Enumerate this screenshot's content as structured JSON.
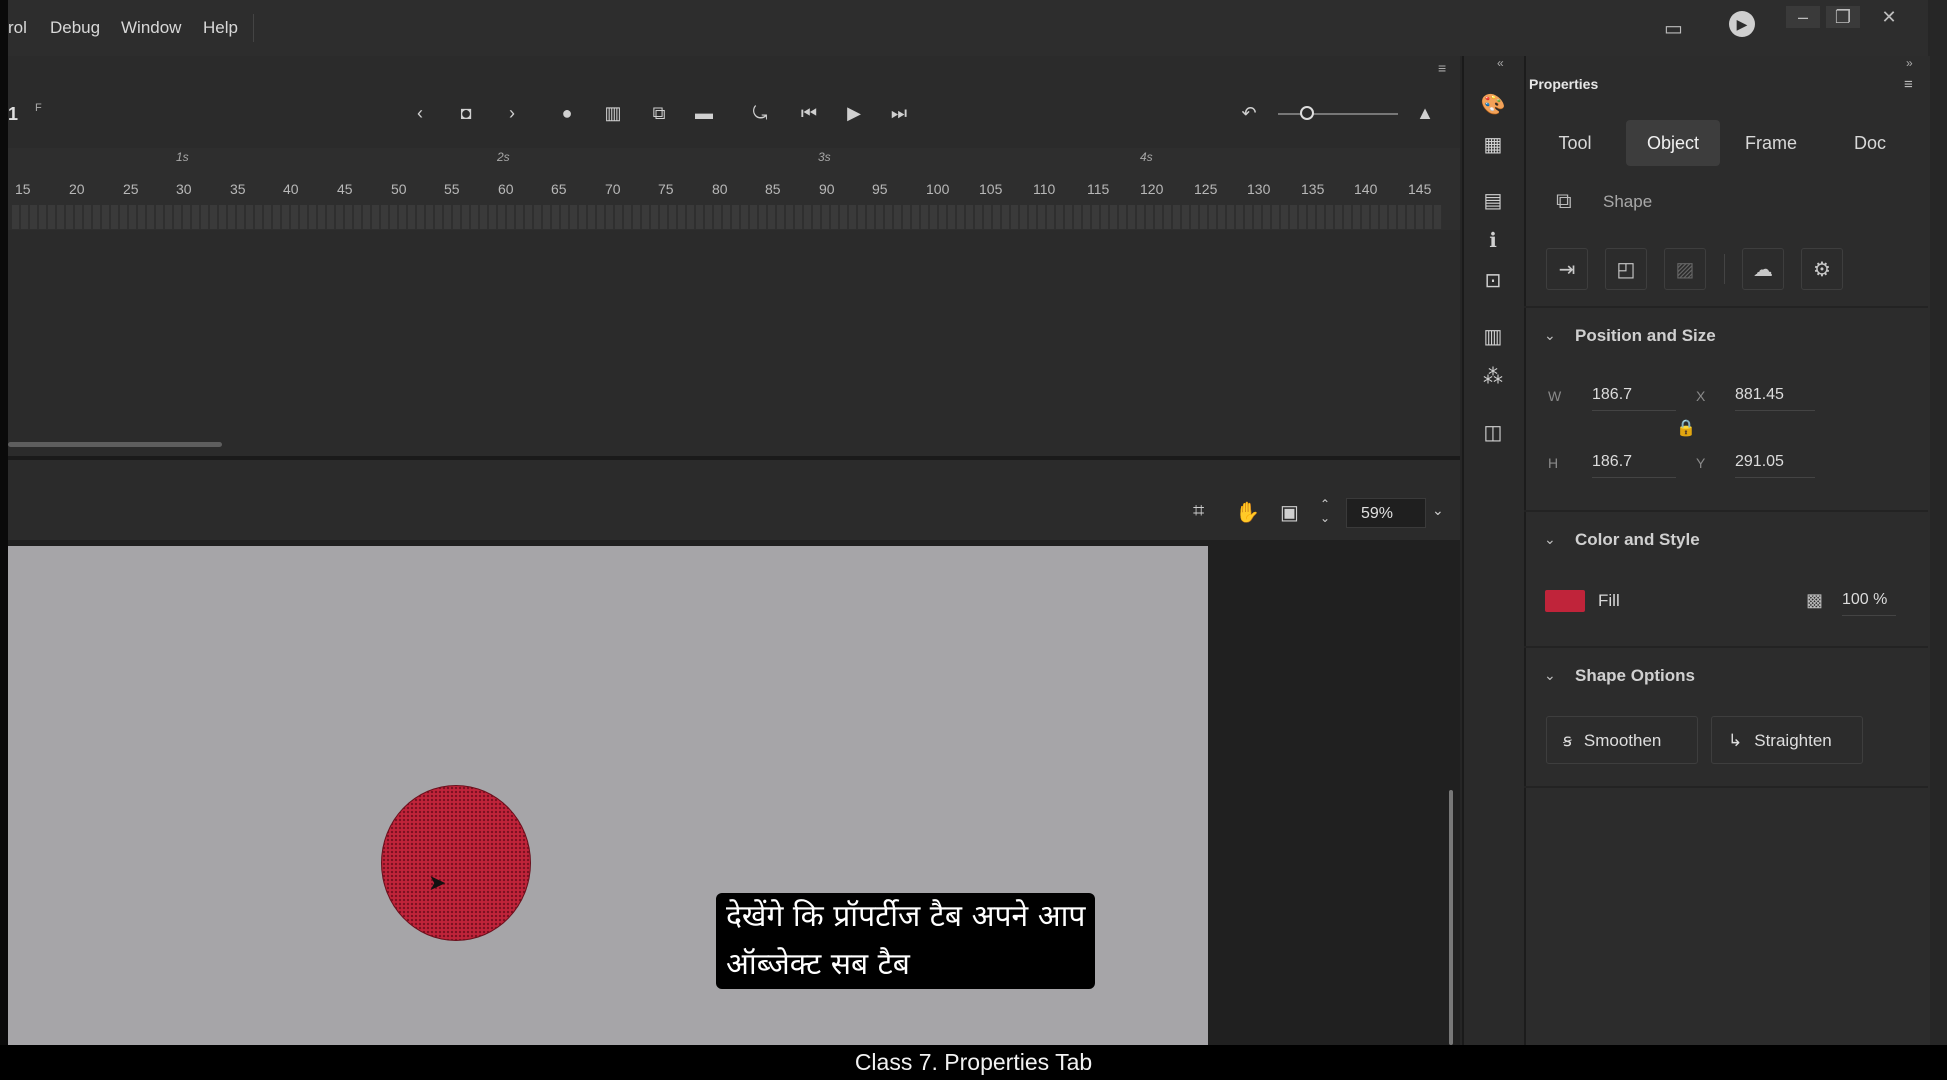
{
  "menu": {
    "items": [
      "rol",
      "Debug",
      "Window",
      "Help"
    ]
  },
  "timeline": {
    "layer_number": "1",
    "frame_indicator": "F",
    "seconds": [
      "1s",
      "2s",
      "3s",
      "4s"
    ],
    "frame_numbers": [
      "15",
      "20",
      "25",
      "30",
      "35",
      "40",
      "45",
      "50",
      "55",
      "60",
      "65",
      "70",
      "75",
      "80",
      "85",
      "90",
      "95",
      "100",
      "105",
      "110",
      "115",
      "120",
      "125",
      "130",
      "135",
      "140",
      "145"
    ]
  },
  "stage": {
    "zoom": "59%",
    "shape_fill": "#c0243a"
  },
  "properties": {
    "title": "Properties",
    "tabs": {
      "tool": "Tool",
      "object": "Object",
      "frame": "Frame",
      "doc": "Doc"
    },
    "active_tab": "Object",
    "object_type": "Shape",
    "position_size": {
      "title": "Position and Size",
      "w_label": "W",
      "w": "186.7",
      "x_label": "X",
      "x": "881.45",
      "h_label": "H",
      "h": "186.7",
      "y_label": "Y",
      "y": "291.05"
    },
    "color_style": {
      "title": "Color and Style",
      "fill_label": "Fill",
      "fill_color": "#c0243a",
      "opacity": "100 %"
    },
    "shape_options": {
      "title": "Shape Options",
      "smoothen": "Smoothen",
      "straighten": "Straighten"
    }
  },
  "subtitle": {
    "line1": "देखेंगे कि प्रॉपर्टीज टैब अपने आप",
    "line2": "ऑब्जेक्ट सब टैब"
  },
  "caption": "Class 7. Properties Tab"
}
